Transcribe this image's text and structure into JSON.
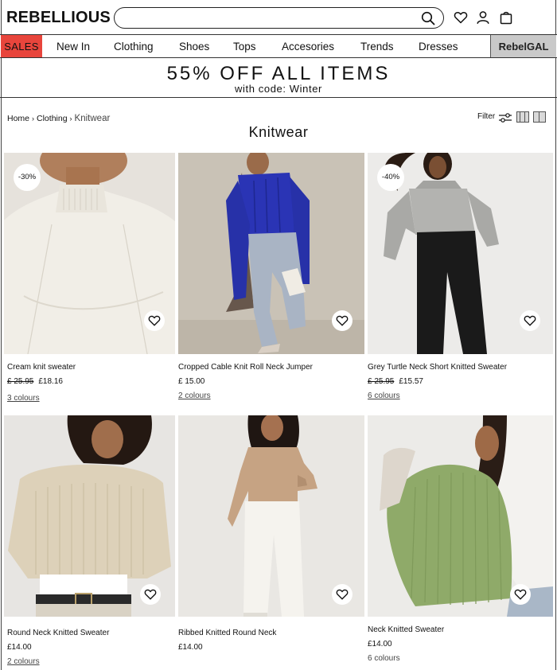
{
  "header": {
    "logo": "REBELLIOUS",
    "search": {
      "value": "",
      "placeholder": ""
    },
    "icons": [
      "search-icon",
      "heart-icon",
      "user-icon",
      "bag-icon"
    ]
  },
  "nav": {
    "items": [
      "SALES",
      "New In",
      "Clothing",
      "Shoes",
      "Tops",
      "Accesories",
      "Trends",
      "Dresses",
      "RebelGAL"
    ]
  },
  "promo": {
    "title": "55% OFF ALL ITEMS",
    "subtitle": "with code: Winter"
  },
  "breadcrumb": {
    "items": [
      "Home",
      "Clothing",
      "Knitwear"
    ],
    "separator": "›"
  },
  "page_title": "Knitwear",
  "toolbar": {
    "filter_label": "Filter"
  },
  "products": [
    {
      "name": "Cream knit sweater",
      "old_price": "£ 25.95",
      "price": "£18.16",
      "colours": "3 colours",
      "badge": "-30%"
    },
    {
      "name": "Cropped Cable Knit Roll Neck Jumper",
      "old_price": "",
      "price": "£ 15.00",
      "colours": "2 colours",
      "badge": ""
    },
    {
      "name": "Grey Turtle Neck Short Knitted Sweater",
      "old_price": "£ 25.95",
      "price": "£15.57",
      "colours": "6 colours",
      "badge": "-40%"
    },
    {
      "name": "Round Neck Knitted Sweater",
      "old_price": "",
      "price": "£14.00",
      "colours": "2 colours",
      "badge": ""
    },
    {
      "name": "Ribbed Knitted Round Neck",
      "old_price": "",
      "price": "£14.00",
      "colours": "",
      "badge": ""
    },
    {
      "name": "Neck Knitted Sweater",
      "old_price": "",
      "price": "£14.00",
      "colours": "6 colours",
      "badge": ""
    }
  ],
  "colors": {
    "sales_bg": "#e8453c",
    "rebelgal_bg": "#c9c9c9",
    "text": "#111111"
  }
}
